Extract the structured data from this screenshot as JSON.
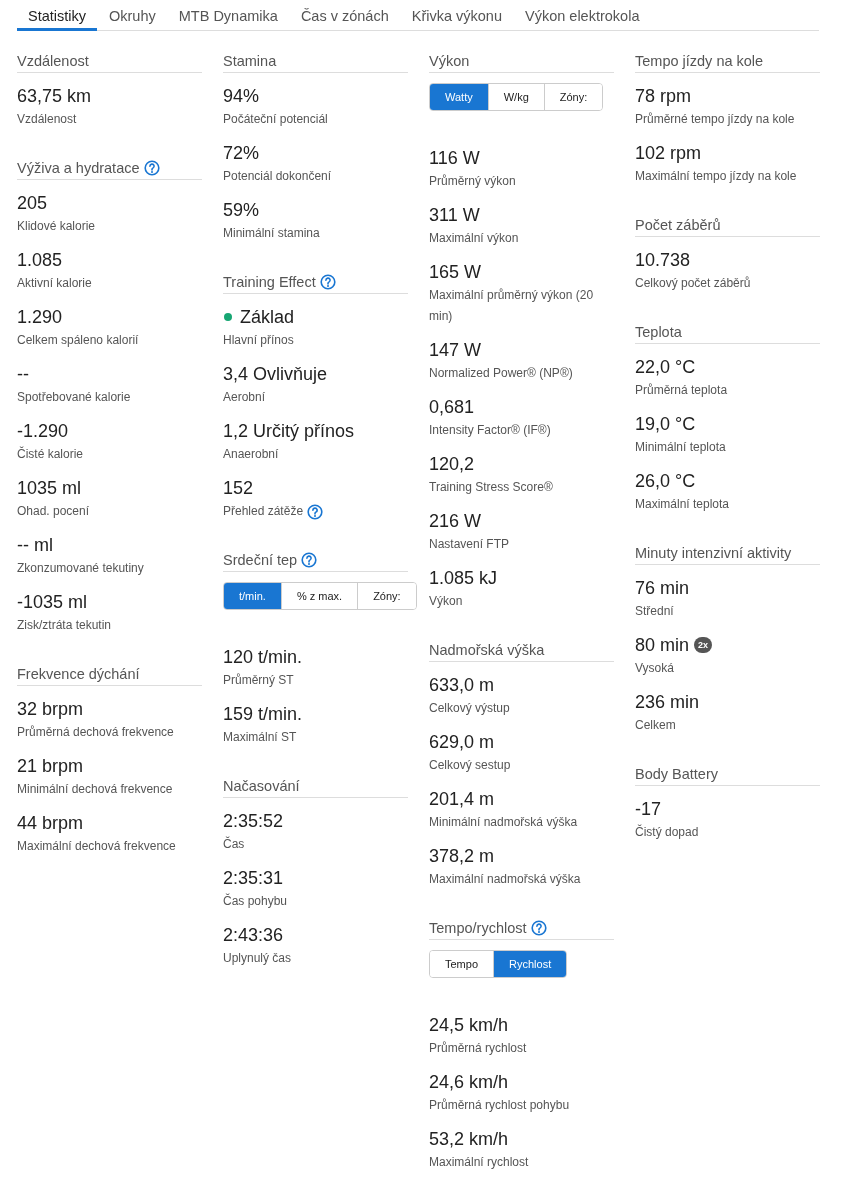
{
  "tabs": [
    {
      "label": "Statistiky",
      "selected": true
    },
    {
      "label": "Okruhy",
      "selected": false
    },
    {
      "label": "MTB Dynamika",
      "selected": false
    },
    {
      "label": "Čas v zónách",
      "selected": false
    },
    {
      "label": "Křivka výkonu",
      "selected": false
    },
    {
      "label": "Výkon elektrokola",
      "selected": false
    }
  ],
  "columns": [
    {
      "sections": [
        {
          "title": "Vzdálenost",
          "help": false,
          "stats": [
            {
              "value": "63,75 km",
              "label": "Vzdálenost"
            }
          ]
        },
        {
          "title": "Výživa a hydratace",
          "help": true,
          "stats": [
            {
              "value": "205",
              "label": "Klidové kalorie"
            },
            {
              "value": "1.085",
              "label": "Aktivní kalorie"
            },
            {
              "value": "1.290",
              "label": "Celkem spáleno kalorií"
            },
            {
              "value": "--",
              "label": "Spotřebované kalorie"
            },
            {
              "value": "-1.290",
              "label": "Čisté kalorie"
            },
            {
              "value": "1035 ml",
              "label": "Ohad. pocení"
            },
            {
              "value": "-- ml",
              "label": "Zkonzumované tekutiny"
            },
            {
              "value": "-1035 ml",
              "label": "Zisk/ztráta tekutin"
            }
          ]
        },
        {
          "title": "Frekvence dýchání",
          "help": false,
          "stats": [
            {
              "value": "32 brpm",
              "label": "Průměrná dechová frekvence"
            },
            {
              "value": "21 brpm",
              "label": "Minimální dechová frekvence"
            },
            {
              "value": "44 brpm",
              "label": "Maximální dechová frekvence"
            }
          ]
        }
      ]
    },
    {
      "sections": [
        {
          "title": "Stamina",
          "help": false,
          "stats": [
            {
              "value": "94%",
              "label": "Počáteční potenciál"
            },
            {
              "value": "72%",
              "label": "Potenciál dokončení"
            },
            {
              "value": "59%",
              "label": "Minimální stamina"
            }
          ]
        },
        {
          "title": "Training Effect",
          "help": true,
          "stats": [
            {
              "value": "Základ",
              "label": "Hlavní přínos",
              "color": "#17a673"
            },
            {
              "value": "3,4 Ovlivňuje",
              "label": "Aerobní"
            },
            {
              "value": "1,2 Určitý přínos",
              "label": "Anaerobní"
            },
            {
              "value": "152",
              "label": "Přehled zátěže",
              "label_help": true
            }
          ]
        },
        {
          "title": "Srdeční tep",
          "help": true,
          "toggle": [
            {
              "label": "t/min.",
              "selected": true
            },
            {
              "label": "% z max.",
              "selected": false
            },
            {
              "label": "Zóny:",
              "selected": false
            }
          ],
          "stats": [
            {
              "value": "120 t/min.",
              "label": "Průměrný ST"
            },
            {
              "value": "159 t/min.",
              "label": "Maximální ST"
            }
          ]
        },
        {
          "title": "Načasování",
          "help": false,
          "stats": [
            {
              "value": "2:35:52",
              "label": "Čas"
            },
            {
              "value": "2:35:31",
              "label": "Čas pohybu"
            },
            {
              "value": "2:43:36",
              "label": "Uplynulý čas"
            }
          ]
        }
      ]
    },
    {
      "sections": [
        {
          "title": "Výkon",
          "help": false,
          "toggle": [
            {
              "label": "Watty",
              "selected": true
            },
            {
              "label": "W/kg",
              "selected": false
            },
            {
              "label": "Zóny:",
              "selected": false
            }
          ],
          "stats": [
            {
              "value": "116 W",
              "label": "Průměrný výkon"
            },
            {
              "value": "311 W",
              "label": "Maximální výkon"
            },
            {
              "value": "165 W",
              "label": "Maximální průměrný výkon (20 min)"
            },
            {
              "value": "147 W",
              "label": "Normalized Power® (NP®)"
            },
            {
              "value": "0,681",
              "label": "Intensity Factor® (IF®)"
            },
            {
              "value": "120,2",
              "label": "Training Stress Score®"
            },
            {
              "value": "216 W",
              "label": "Nastavení FTP"
            },
            {
              "value": "1.085 kJ",
              "label": "Výkon"
            }
          ]
        },
        {
          "title": "Nadmořská výška",
          "help": false,
          "stats": [
            {
              "value": "633,0 m",
              "label": "Celkový výstup"
            },
            {
              "value": "629,0 m",
              "label": "Celkový sestup"
            },
            {
              "value": "201,4 m",
              "label": "Minimální nadmořská výška"
            },
            {
              "value": "378,2 m",
              "label": "Maximální nadmořská výška"
            }
          ]
        },
        {
          "title": "Tempo/rychlost",
          "help": true,
          "toggle": [
            {
              "label": "Tempo",
              "selected": false
            },
            {
              "label": "Rychlost",
              "selected": true
            }
          ],
          "stats": [
            {
              "value": "24,5 km/h",
              "label": "Průměrná rychlost"
            },
            {
              "value": "24,6 km/h",
              "label": "Průměrná rychlost pohybu"
            },
            {
              "value": "53,2 km/h",
              "label": "Maximální rychlost"
            }
          ]
        }
      ]
    },
    {
      "sections": [
        {
          "title": "Tempo jízdy na kole",
          "help": false,
          "stats": [
            {
              "value": "78 rpm",
              "label": "Průměrné tempo jízdy na kole"
            },
            {
              "value": "102 rpm",
              "label": "Maximální tempo jízdy na kole"
            }
          ]
        },
        {
          "title": "Počet záběrů",
          "help": false,
          "stats": [
            {
              "value": "10.738",
              "label": "Celkový počet záběrů"
            }
          ]
        },
        {
          "title": "Teplota",
          "help": false,
          "stats": [
            {
              "value": "22,0 °C",
              "label": "Průměrná teplota"
            },
            {
              "value": "19,0 °C",
              "label": "Minimální teplota"
            },
            {
              "value": "26,0 °C",
              "label": "Maximální teplota"
            }
          ]
        },
        {
          "title": "Minuty intenzivní aktivity",
          "help": false,
          "stats": [
            {
              "value": "76 min",
              "label": "Střední"
            },
            {
              "value": "80 min",
              "label": "Vysoká",
              "badge": "2x"
            },
            {
              "value": "236 min",
              "label": "Celkem"
            }
          ]
        },
        {
          "title": "Body Battery",
          "help": false,
          "stats": [
            {
              "value": "-17",
              "label": "Čistý dopad"
            }
          ]
        }
      ]
    }
  ]
}
